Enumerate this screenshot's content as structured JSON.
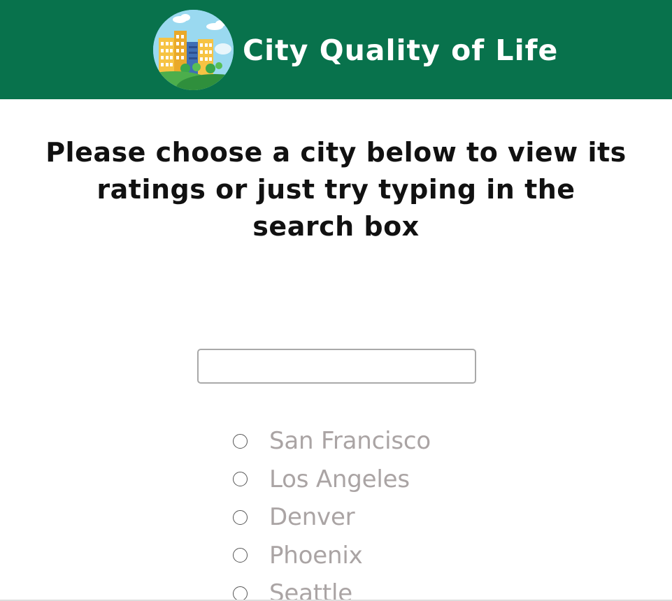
{
  "header": {
    "title": "City Quality of Life",
    "logo_icon": "city-skyline-icon",
    "background_color": "#08724c"
  },
  "main": {
    "prompt": "Please choose a city below to view its ratings or just try typing in the search box",
    "search": {
      "value": "",
      "placeholder": ""
    },
    "cities": [
      {
        "label": "San Francisco",
        "selected": false
      },
      {
        "label": "Los Angeles",
        "selected": false
      },
      {
        "label": "Denver",
        "selected": false
      },
      {
        "label": "Phoenix",
        "selected": false
      },
      {
        "label": "Seattle",
        "selected": false
      }
    ],
    "city_label_color": "#aaa4a4"
  }
}
